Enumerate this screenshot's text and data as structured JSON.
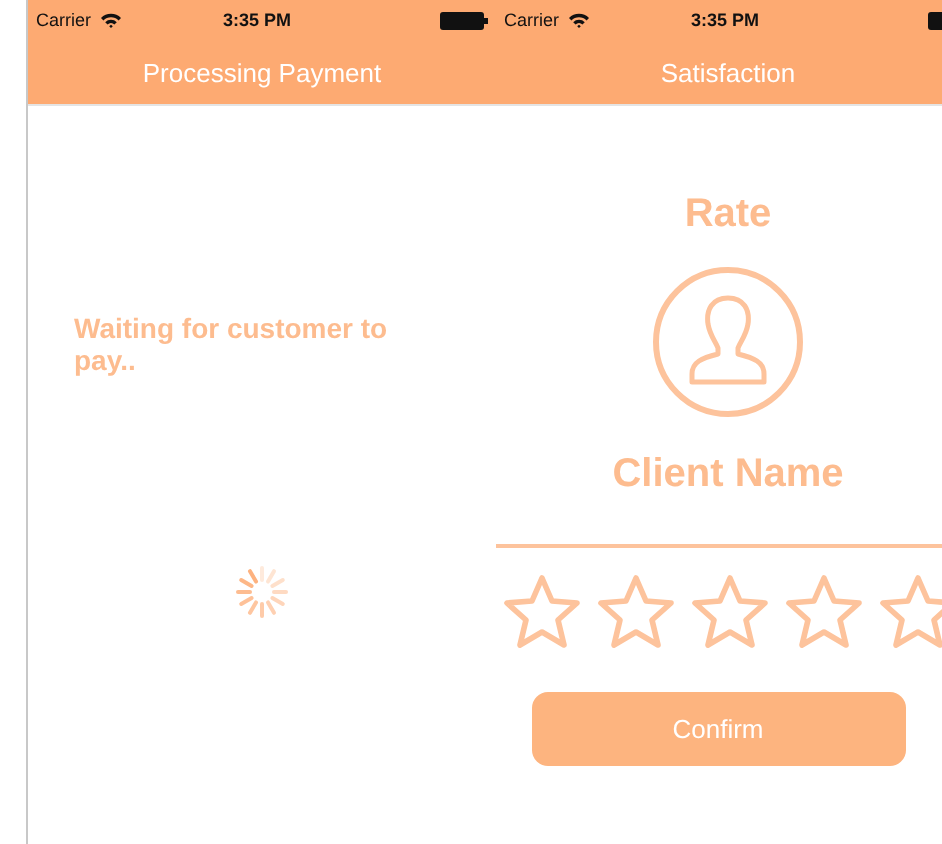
{
  "screens": [
    {
      "status_bar": {
        "carrier": "Carrier",
        "time": "3:35 PM"
      },
      "title": "Processing Payment",
      "message": "Waiting for customer to pay..",
      "kind": "processing"
    },
    {
      "status_bar": {
        "carrier": "Carrier",
        "time": "3:35 PM"
      },
      "title": "Satisfaction",
      "heading": "Rate",
      "client_name": "Client Name",
      "stars": 0,
      "button": "Confirm",
      "kind": "rating"
    }
  ]
}
